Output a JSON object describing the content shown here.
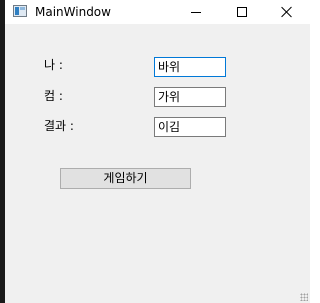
{
  "window": {
    "title": "MainWindow",
    "controls": {
      "minimize": "minimize-icon",
      "maximize": "maximize-icon",
      "close": "close-icon"
    }
  },
  "form": {
    "me_label": "나 :",
    "com_label": "컴 :",
    "result_label": "결과 :",
    "me_value": "바위",
    "com_value": "가위",
    "result_value": "이김"
  },
  "actions": {
    "play_label": "게임하기"
  },
  "colors": {
    "window_bg": "#f0f0f0",
    "titlebar_bg": "#ffffff",
    "focus_border": "#0078d7",
    "button_bg": "#e1e1e1"
  }
}
